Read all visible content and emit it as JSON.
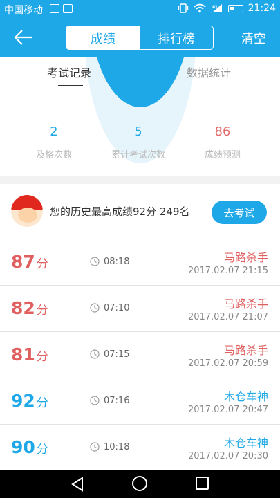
{
  "status_bar": {
    "carrier": "中国移动",
    "network": "4G",
    "time": "21:24"
  },
  "header": {
    "tabs": [
      {
        "label": "成绩",
        "active": true
      },
      {
        "label": "排行榜",
        "active": false
      }
    ],
    "clear_label": "清空"
  },
  "sub_tabs": [
    {
      "label": "考试记录",
      "active": true
    },
    {
      "label": "数据统计",
      "active": false
    }
  ],
  "stats": [
    {
      "value": "2",
      "label": "及格次数"
    },
    {
      "value": "5",
      "label": "累计考试次数"
    },
    {
      "value": "86",
      "label": "成绩预测"
    }
  ],
  "best": {
    "text": "您的历史最高成绩92分  249名",
    "button": "去考试"
  },
  "score_unit": "分",
  "records": [
    {
      "score": "87",
      "duration": "08:18",
      "title": "马路杀手",
      "datetime": "2017.02.07  21:15",
      "pass": false
    },
    {
      "score": "82",
      "duration": "07:10",
      "title": "马路杀手",
      "datetime": "2017.02.07  21:07",
      "pass": false
    },
    {
      "score": "81",
      "duration": "07:15",
      "title": "马路杀手",
      "datetime": "2017.02.07  20:59",
      "pass": false
    },
    {
      "score": "92",
      "duration": "07:16",
      "title": "木仓车神",
      "datetime": "2017.02.07  20:47",
      "pass": true
    },
    {
      "score": "90",
      "duration": "10:18",
      "title": "木仓车神",
      "datetime": "2017.02.07  20:30",
      "pass": true
    }
  ],
  "colors": {
    "accent": "#1fa8e8",
    "fail": "#e06060"
  },
  "icons": {
    "back": "arrow-left-icon",
    "clock": "clock-icon",
    "avatar": "cartoon-avatar"
  }
}
